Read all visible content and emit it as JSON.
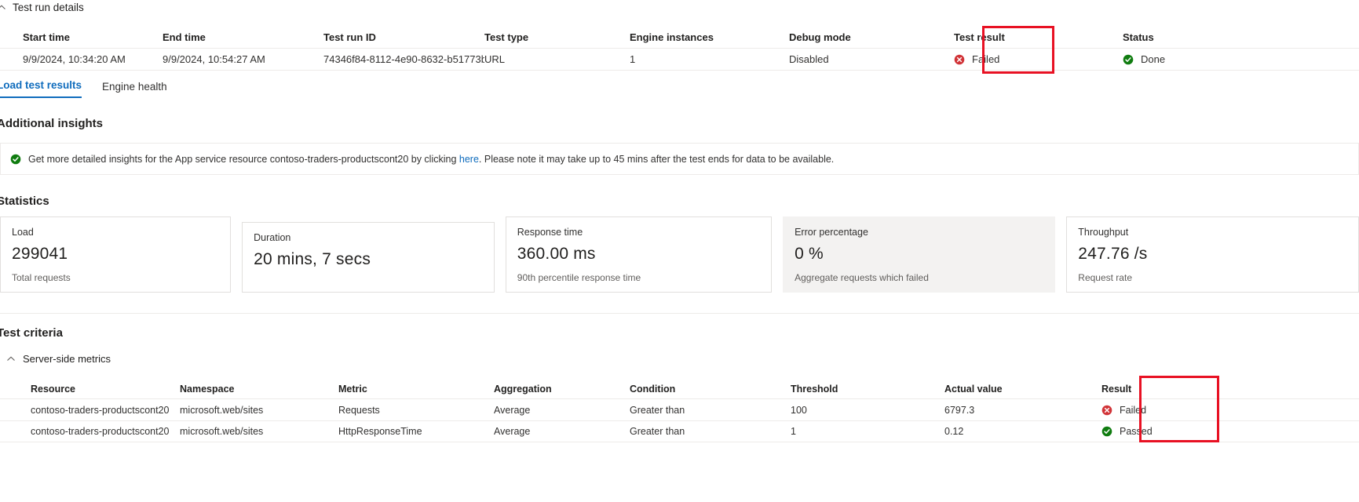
{
  "details_section": {
    "title": "Test run details",
    "collapse_icon": "chevron-up-icon",
    "columns": [
      "Start time",
      "End time",
      "Test run ID",
      "Test type",
      "Engine instances",
      "Debug mode",
      "Test result",
      "Status"
    ],
    "row": {
      "start_time": "9/9/2024, 10:34:20 AM",
      "end_time": "9/9/2024, 10:54:27 AM",
      "test_run_id": "74346f84-8112-4e90-8632-b51773b...",
      "test_type": "URL",
      "engine_instances": "1",
      "debug_mode": "Disabled",
      "test_result": "Failed",
      "test_result_icon": "error-circle-icon",
      "status": "Done",
      "status_icon": "success-circle-icon"
    }
  },
  "tabs": [
    {
      "label": "Load test results",
      "active": true
    },
    {
      "label": "Engine health",
      "active": false
    }
  ],
  "insights": {
    "title": "Additional insights",
    "icon": "success-circle-icon",
    "text_before_link": "Get more detailed insights for the App service resource contoso-traders-productscont20 by clicking ",
    "link_text": "here",
    "text_after_link": ". Please note it may take up to 45 mins after the test ends for data to be available."
  },
  "statistics": {
    "title": "Statistics",
    "cards": [
      {
        "label": "Load",
        "value": "299041",
        "caption": "Total requests",
        "highlighted": false
      },
      {
        "label": "Duration",
        "value": "20 mins, 7 secs",
        "caption": "",
        "highlighted": false
      },
      {
        "label": "Response time",
        "value": "360.00 ms",
        "caption": "90th percentile response time",
        "highlighted": false
      },
      {
        "label": "Error percentage",
        "value": "0 %",
        "caption": "Aggregate requests which failed",
        "highlighted": true
      },
      {
        "label": "Throughput",
        "value": "247.76 /s",
        "caption": "Request rate",
        "highlighted": false
      }
    ]
  },
  "test_criteria": {
    "title": "Test criteria",
    "group_label": "Server-side metrics",
    "group_icon": "chevron-up-icon",
    "columns": [
      "Resource",
      "Namespace",
      "Metric",
      "Aggregation",
      "Condition",
      "Threshold",
      "Actual value",
      "Result"
    ],
    "rows": [
      {
        "resource": "contoso-traders-productscont20",
        "namespace": "microsoft.web/sites",
        "metric": "Requests",
        "aggregation": "Average",
        "condition": "Greater than",
        "threshold": "100",
        "actual_value": "6797.3",
        "result": "Failed",
        "result_icon": "error-circle-icon"
      },
      {
        "resource": "contoso-traders-productscont20",
        "namespace": "microsoft.web/sites",
        "metric": "HttpResponseTime",
        "aggregation": "Average",
        "condition": "Greater than",
        "threshold": "1",
        "actual_value": "0.12",
        "result": "Passed",
        "result_icon": "success-circle-icon"
      }
    ]
  },
  "annotations": {
    "color": "#e81123",
    "boxes": [
      "test-result-column-highlight",
      "criteria-result-column-highlight"
    ]
  }
}
